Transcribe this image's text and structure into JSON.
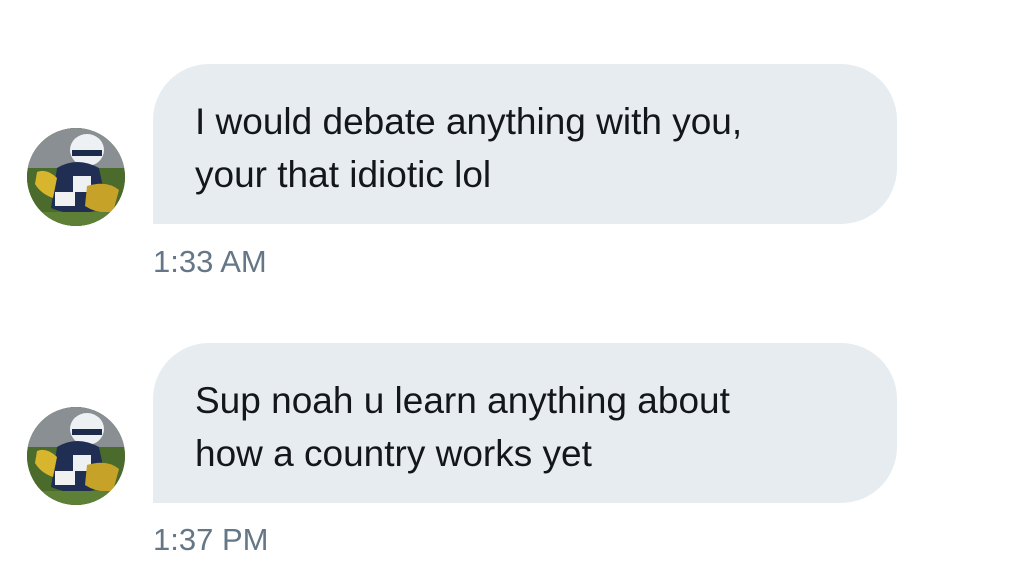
{
  "conversation": {
    "messages": [
      {
        "lines": [
          "I would debate anything with you,",
          "your that idiotic lol"
        ],
        "timestamp": "1:33 AM",
        "avatar_icon": "user-avatar-icon"
      },
      {
        "lines": [
          "Sup noah u learn anything about",
          "how a country works yet"
        ],
        "timestamp": "1:37 PM",
        "avatar_icon": "user-avatar-icon"
      }
    ]
  },
  "colors": {
    "bubble_background": "#e6ecf0",
    "message_text": "#14171a",
    "timestamp_text": "#657786",
    "page_background": "#ffffff"
  }
}
